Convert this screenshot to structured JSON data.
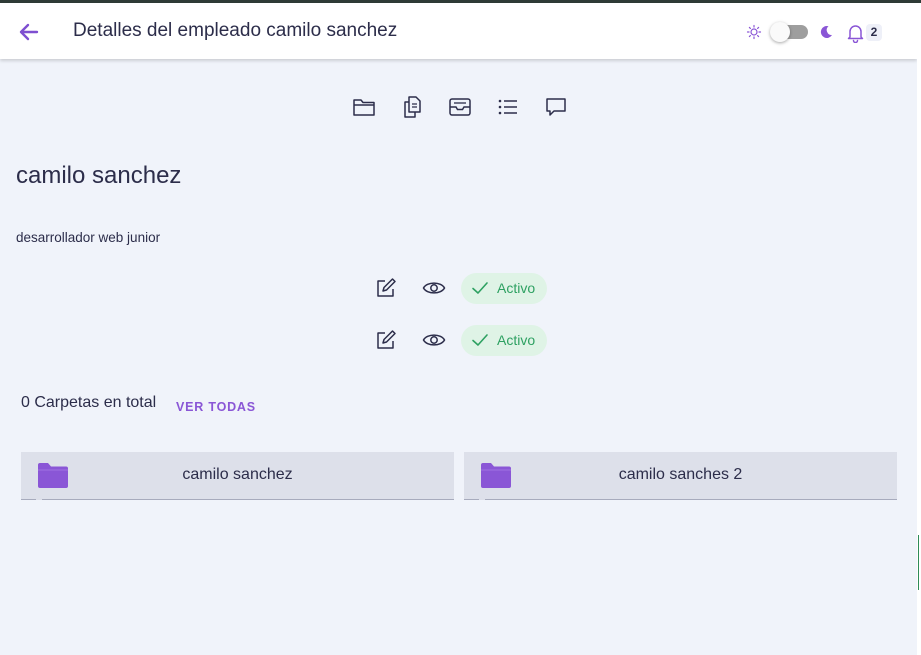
{
  "header": {
    "title": "Detalles del empleado camilo sanchez",
    "back_icon": "arrow-left-icon",
    "theme_toggle": {
      "state": "off",
      "light_icon": "sun-icon",
      "dark_icon": "moon-icon"
    },
    "notifications": {
      "icon": "bell-icon",
      "count": "2"
    }
  },
  "toolbar": {
    "icons": [
      "folder-icon",
      "documents-icon",
      "inbox-icon",
      "list-icon",
      "comment-icon"
    ]
  },
  "employee": {
    "name": "camilo sanchez",
    "role": "desarrollador web junior"
  },
  "documents": [
    {
      "status": "Activo",
      "edit_icon": "edit-icon",
      "view_icon": "eye-icon"
    },
    {
      "status": "Activo",
      "edit_icon": "edit-icon",
      "view_icon": "eye-icon"
    }
  ],
  "folders_section": {
    "count_label": "0 Carpetas en total",
    "see_all_label": "VER TODAS"
  },
  "folders": [
    {
      "name": "camilo sanchez"
    },
    {
      "name": "camilo sanches 2"
    }
  ],
  "colors": {
    "accent": "#8a56d6",
    "status_active_bg": "#dff3e6",
    "status_active_text": "#2ea162",
    "page_bg": "#f0f3fa",
    "folder_card_bg": "#dde0ea",
    "text": "#2c2d4a"
  }
}
